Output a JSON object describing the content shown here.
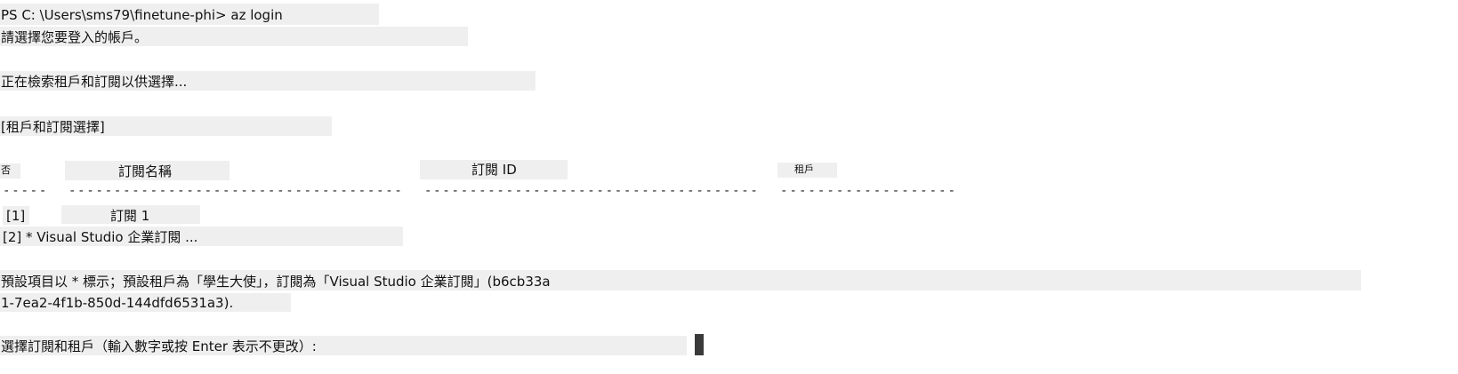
{
  "terminal": {
    "prompt_line": "PS C: \\Users\\sms79\\finetune-phi> az login",
    "select_account": "請選擇您要登入的帳戶。",
    "retrieving": "正在檢索租戶和訂閱以供選擇...",
    "section_header": "[租戶和訂閱選擇]",
    "columns": {
      "no": "否",
      "subscription_name": "訂閱名稱",
      "subscription_id": "訂閱 ID",
      "tenant": "租戶"
    },
    "dashes": {
      "no": "-----",
      "subscription_name": "-------------------------------------",
      "subscription_id": "-------------------------------------",
      "tenant": "-------------------"
    },
    "rows": [
      {
        "index": "[1]",
        "name": "訂閱 1"
      },
      {
        "line": "[2] * Visual Studio 企業訂閱 ..."
      }
    ],
    "default_line_1": "預設項目以 * 標示；預設租戶為「學生大使」，訂閱為「Visual Studio 企業訂閱」(b6cb33a",
    "default_line_2": "1-7ea2-4f1b-850d-144dfd6531a3).",
    "select_prompt": "選擇訂閱和租戶（輸入數字或按 Enter 表示不更改）:"
  }
}
